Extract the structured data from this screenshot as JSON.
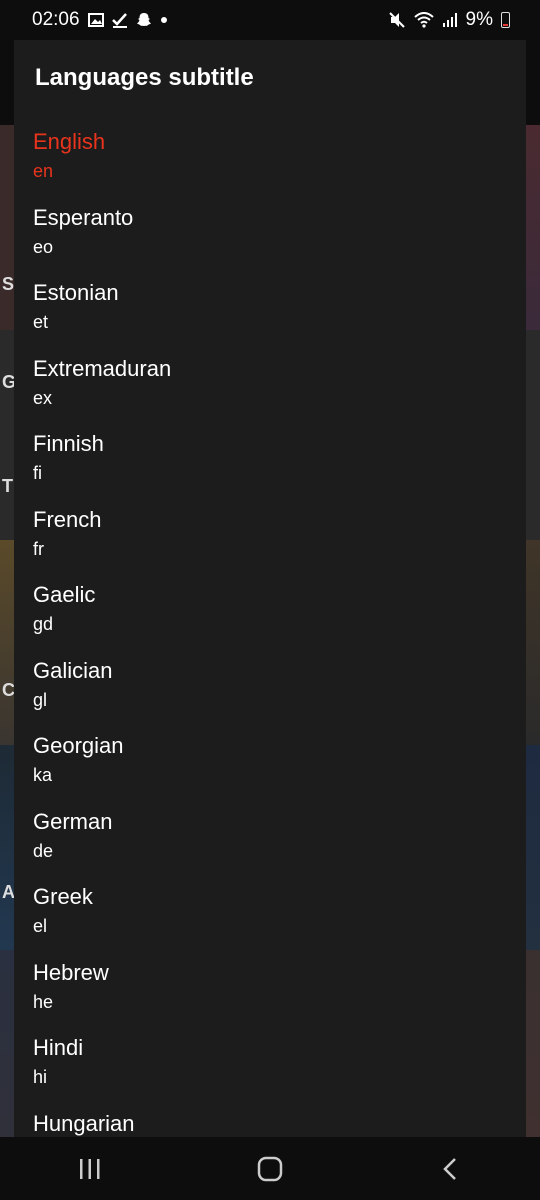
{
  "status_bar": {
    "time": "02:06",
    "battery_text": "9%",
    "icons_left": [
      "gallery-icon",
      "check-icon",
      "snapchat-icon",
      "dot-icon"
    ],
    "icons_right": [
      "mute-icon",
      "wifi-icon",
      "signal-icon",
      "battery-icon"
    ]
  },
  "dialog": {
    "title": "Languages subtitle",
    "accent_color": "#e8341c",
    "items": [
      {
        "name": "English",
        "code": "en",
        "selected": true
      },
      {
        "name": "Esperanto",
        "code": "eo"
      },
      {
        "name": "Estonian",
        "code": "et"
      },
      {
        "name": "Extremaduran",
        "code": "ex"
      },
      {
        "name": "Finnish",
        "code": "fi"
      },
      {
        "name": "French",
        "code": "fr"
      },
      {
        "name": "Gaelic",
        "code": "gd"
      },
      {
        "name": "Galician",
        "code": "gl"
      },
      {
        "name": "Georgian",
        "code": "ka"
      },
      {
        "name": "German",
        "code": "de"
      },
      {
        "name": "Greek",
        "code": "el"
      },
      {
        "name": "Hebrew",
        "code": "he"
      },
      {
        "name": "Hindi",
        "code": "hi"
      },
      {
        "name": "Hungarian",
        "code": ""
      }
    ]
  },
  "background_letters": [
    "S",
    "G",
    "T",
    "C",
    "A"
  ],
  "navbar": {
    "buttons": [
      "recents-icon",
      "home-icon",
      "back-icon"
    ]
  }
}
